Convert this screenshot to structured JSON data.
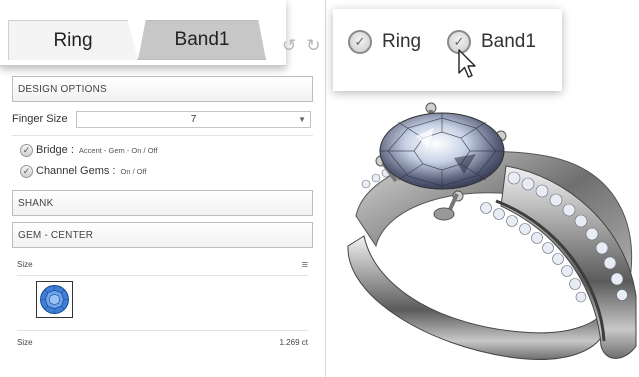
{
  "tabs": [
    {
      "label": "Ring",
      "active": true
    },
    {
      "label": "Band1",
      "active": false
    }
  ],
  "toolbar_icons": [
    "undo-icon",
    "redo-icon"
  ],
  "sections": {
    "design_options": "DESIGN OPTIONS",
    "shank": "SHANK",
    "gem_center": "GEM - CENTER"
  },
  "finger_size": {
    "label": "Finger Size",
    "value": "7"
  },
  "options": [
    {
      "name": "Bridge :",
      "desc": "Accent - Gem - On / Off",
      "checked": true
    },
    {
      "name": "Channel Gems :",
      "desc": "On / Off",
      "checked": true
    }
  ],
  "gem": {
    "size_label": "Size",
    "size_value_label": "Size",
    "size_value": "1.269 ct",
    "shape_icon": "round-brilliant-icon",
    "shape_color": "#3f7fd6"
  },
  "callout": {
    "items": [
      {
        "label": "Ring",
        "checked": true
      },
      {
        "label": "Band1",
        "checked": true
      }
    ]
  },
  "colors": {
    "tab_active": "#f4f4f4",
    "tab_inactive": "#c7c7c7",
    "metal": "#8e8e8e"
  }
}
